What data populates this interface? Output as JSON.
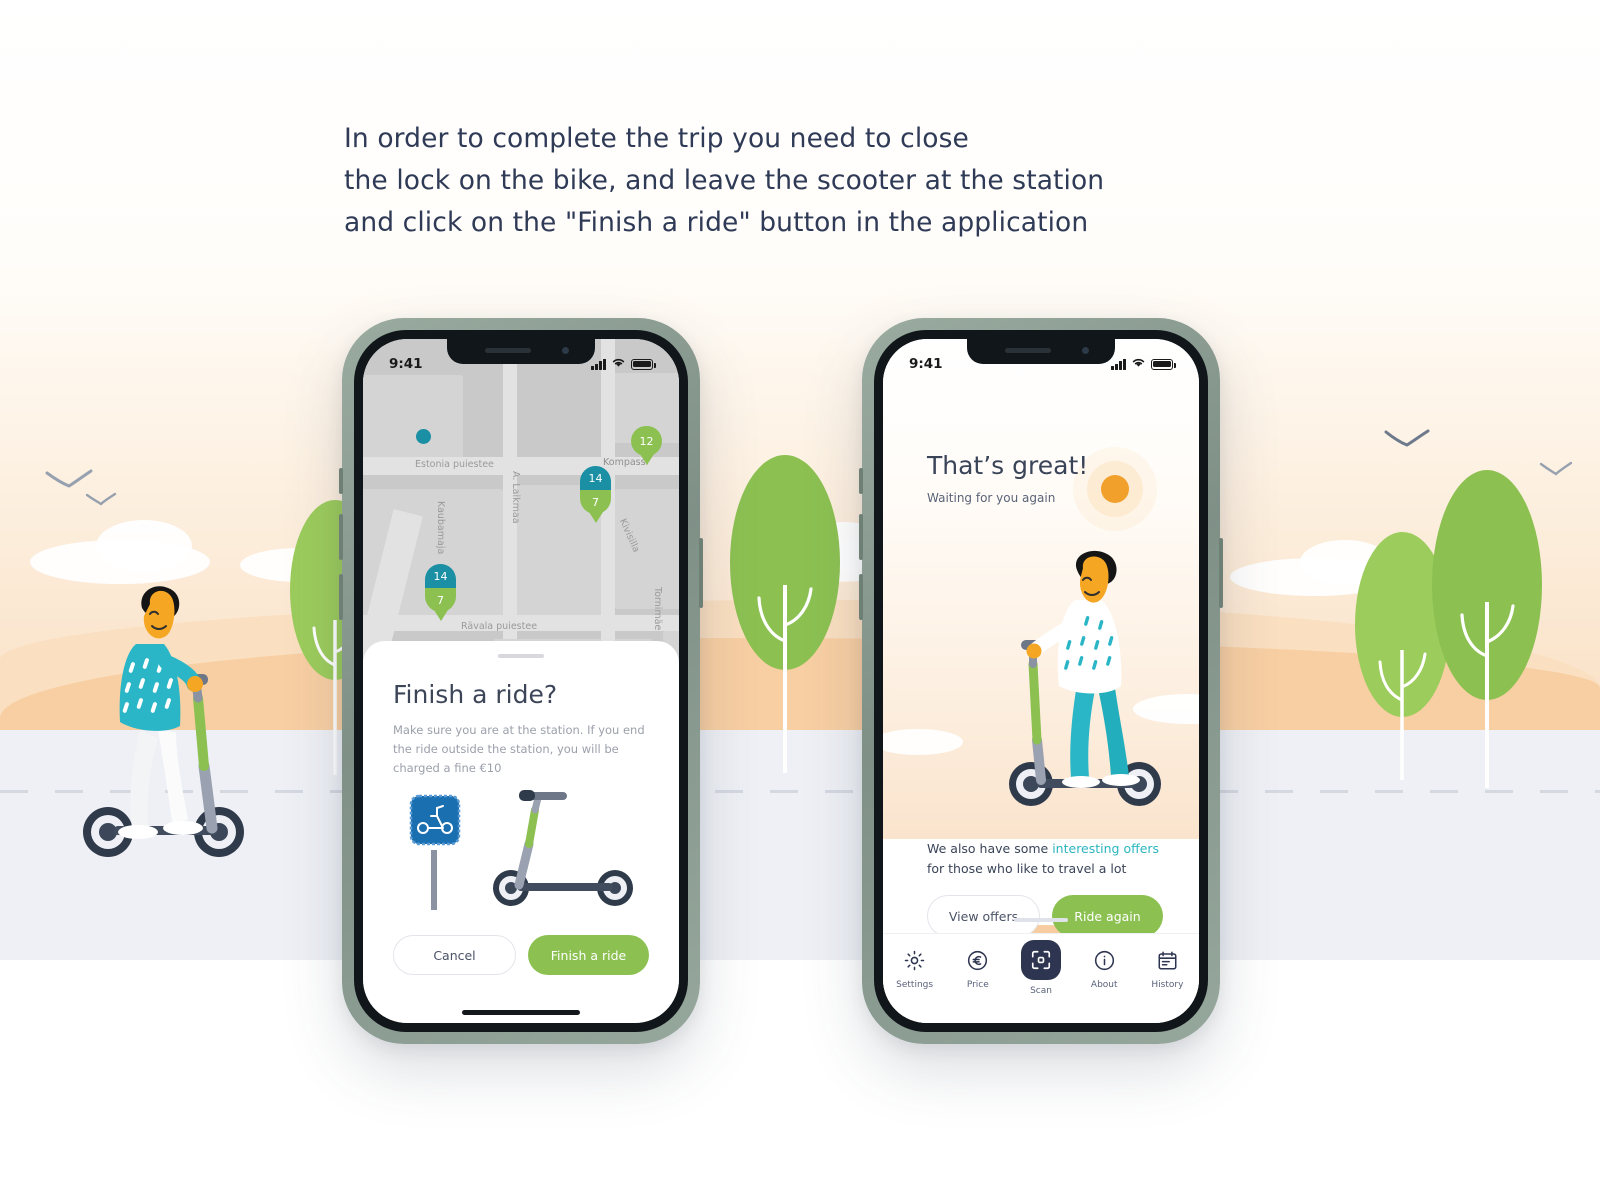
{
  "headline": {
    "line1": "In order to complete the trip you need to close",
    "line2": "the lock on the bike, and leave the scooter at the station",
    "line3": "and click on the \"Finish a ride\" button in the application"
  },
  "colors": {
    "green": "#8cc152",
    "teal": "#1b8fa3",
    "link_teal": "#2cb5c0",
    "navy": "#2d3550",
    "sun_orange": "#f2a02c",
    "sand": "#f8cfa3",
    "road": "#eef0f5",
    "phone_frame": "#8fa398"
  },
  "phone_one": {
    "status_bar": {
      "time": "9:41",
      "signal_icon": "cellular-bars-icon",
      "wifi_icon": "wifi-icon",
      "battery_icon": "battery-icon"
    },
    "map": {
      "street_labels": [
        "Estonia puiestee",
        "Kompassi",
        "Kaubamaja",
        "A. Laikmaa",
        "Kivisilla",
        "Rävala puiestee",
        "Tornimäe"
      ],
      "pins": [
        {
          "bikes": "14",
          "scooters": "7"
        },
        {
          "bikes": "14",
          "scooters": "7"
        },
        {
          "scooters": "12"
        }
      ],
      "locate_icon": "locate-me-icon"
    },
    "sheet": {
      "title": "Finish a ride?",
      "description": "Make sure you are at the station. If you end the ride outside the station, you will be charged a fine €10",
      "illustration": "scooter-parking-sign-illustration",
      "cancel_label": "Cancel",
      "confirm_label": "Finish a ride"
    }
  },
  "phone_two": {
    "status_bar": {
      "time": "9:41",
      "signal_icon": "cellular-bars-icon",
      "wifi_icon": "wifi-icon",
      "battery_icon": "battery-icon"
    },
    "title": "That’s great!",
    "subtitle": "Waiting for you again",
    "sun_icon": "sun-icon",
    "illustration": "rider-on-scooter-illustration",
    "offer": {
      "prefix": "We also have some ",
      "link": "interesting offers",
      "suffix": " for those who like to travel a lot"
    },
    "view_offers_label": "View offers",
    "ride_again_label": "Ride again",
    "tabs": [
      {
        "label": "Settings",
        "icon": "gear-icon",
        "active": false
      },
      {
        "label": "Price",
        "icon": "euro-circle-icon",
        "active": false
      },
      {
        "label": "Scan",
        "icon": "scan-qr-icon",
        "active": true
      },
      {
        "label": "About",
        "icon": "info-circle-icon",
        "active": false
      },
      {
        "label": "History",
        "icon": "calendar-icon",
        "active": false
      }
    ]
  },
  "scene": {
    "left_rider": "rider-pushing-scooter-illustration",
    "trees": "green-trees",
    "birds": "flying-birds",
    "clouds": "clouds"
  }
}
